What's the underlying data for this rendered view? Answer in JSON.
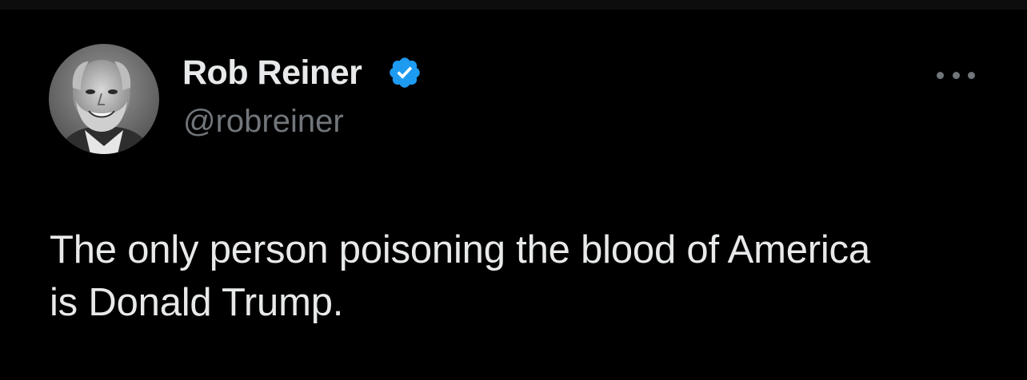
{
  "author": {
    "display_name": "Rob Reiner",
    "handle": "@robreiner",
    "verified": true,
    "avatar_icon": "profile-photo"
  },
  "tweet": {
    "text_lines": [
      "The only person poisoning the blood of America",
      "is Donald Trump."
    ]
  },
  "icons": {
    "verified": "verified-badge-icon",
    "more": "more-options-icon"
  },
  "colors": {
    "background": "#000000",
    "text": "#e7e9ea",
    "secondary_text": "#71767b",
    "verified_blue": "#1d9bf0"
  }
}
